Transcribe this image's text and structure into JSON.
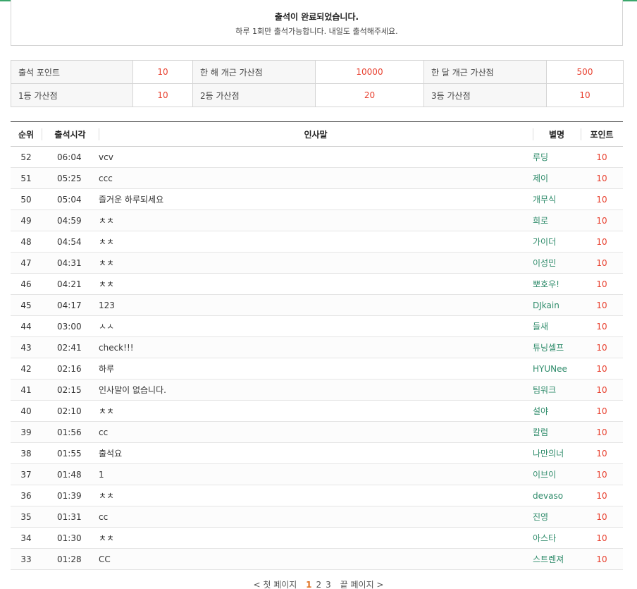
{
  "notice": {
    "title": "출석이 완료되었습니다.",
    "subtitle": "하루 1회만 출석가능합니다. 내일도 출석해주세요."
  },
  "info": [
    [
      {
        "label": "출석 포인트",
        "value": "10"
      },
      {
        "label": "한 해 개근 가산점",
        "value": "10000"
      },
      {
        "label": "한 달 개근 가산점",
        "value": "500"
      }
    ],
    [
      {
        "label": "1등 가산점",
        "value": "10"
      },
      {
        "label": "2등 가산점",
        "value": "20"
      },
      {
        "label": "3등 가산점",
        "value": "10"
      }
    ]
  ],
  "table": {
    "headers": {
      "rank": "순위",
      "time": "출석시각",
      "message": "인사말",
      "nickname": "별명",
      "points": "포인트"
    },
    "rows": [
      {
        "rank": "52",
        "time": "06:04",
        "message": "vcv",
        "nickname": "루딩",
        "points": "10"
      },
      {
        "rank": "51",
        "time": "05:25",
        "message": "ccc",
        "nickname": "제이",
        "points": "10"
      },
      {
        "rank": "50",
        "time": "05:04",
        "message": "즐거운 하루되세요",
        "nickname": "개무식",
        "points": "10"
      },
      {
        "rank": "49",
        "time": "04:59",
        "message": "ㅊㅊ",
        "nickname": "희로",
        "points": "10"
      },
      {
        "rank": "48",
        "time": "04:54",
        "message": "ㅊㅊ",
        "nickname": "가이더",
        "points": "10"
      },
      {
        "rank": "47",
        "time": "04:31",
        "message": "ㅊㅊ",
        "nickname": "이성민",
        "points": "10"
      },
      {
        "rank": "46",
        "time": "04:21",
        "message": "ㅊㅊ",
        "nickname": "뽀호우!",
        "points": "10"
      },
      {
        "rank": "45",
        "time": "04:17",
        "message": "123",
        "nickname": "DJkain",
        "points": "10"
      },
      {
        "rank": "44",
        "time": "03:00",
        "message": "ㅅㅅ",
        "nickname": "들새",
        "points": "10"
      },
      {
        "rank": "43",
        "time": "02:41",
        "message": "check!!!",
        "nickname": "튜닝셀프",
        "points": "10"
      },
      {
        "rank": "42",
        "time": "02:16",
        "message": "하루",
        "nickname": "HYUNee",
        "points": "10"
      },
      {
        "rank": "41",
        "time": "02:15",
        "message": "인사말이 없습니다.",
        "nickname": "팀워크",
        "points": "10"
      },
      {
        "rank": "40",
        "time": "02:10",
        "message": "ㅊㅊ",
        "nickname": "설야",
        "points": "10"
      },
      {
        "rank": "39",
        "time": "01:56",
        "message": "cc",
        "nickname": "칼럼",
        "points": "10"
      },
      {
        "rank": "38",
        "time": "01:55",
        "message": "출석요",
        "nickname": "나만의너",
        "points": "10"
      },
      {
        "rank": "37",
        "time": "01:48",
        "message": "1",
        "nickname": "이브이",
        "points": "10"
      },
      {
        "rank": "36",
        "time": "01:39",
        "message": "ㅊㅊ",
        "nickname": "devaso",
        "points": "10"
      },
      {
        "rank": "35",
        "time": "01:31",
        "message": "cc",
        "nickname": "진영",
        "points": "10"
      },
      {
        "rank": "34",
        "time": "01:30",
        "message": "ㅊㅊ",
        "nickname": "아스타",
        "points": "10"
      },
      {
        "rank": "33",
        "time": "01:28",
        "message": "CC",
        "nickname": "스트렌져",
        "points": "10"
      }
    ]
  },
  "pager": {
    "first": "< 첫 페이지",
    "pages": [
      "1",
      "2",
      "3"
    ],
    "current": "1",
    "last": "끝 페이지 >"
  },
  "colors": {
    "accent_line": "#3aa66b",
    "point_red": "#e8402f",
    "nick_green": "#2e8b6a",
    "current_page": "#e07020"
  }
}
